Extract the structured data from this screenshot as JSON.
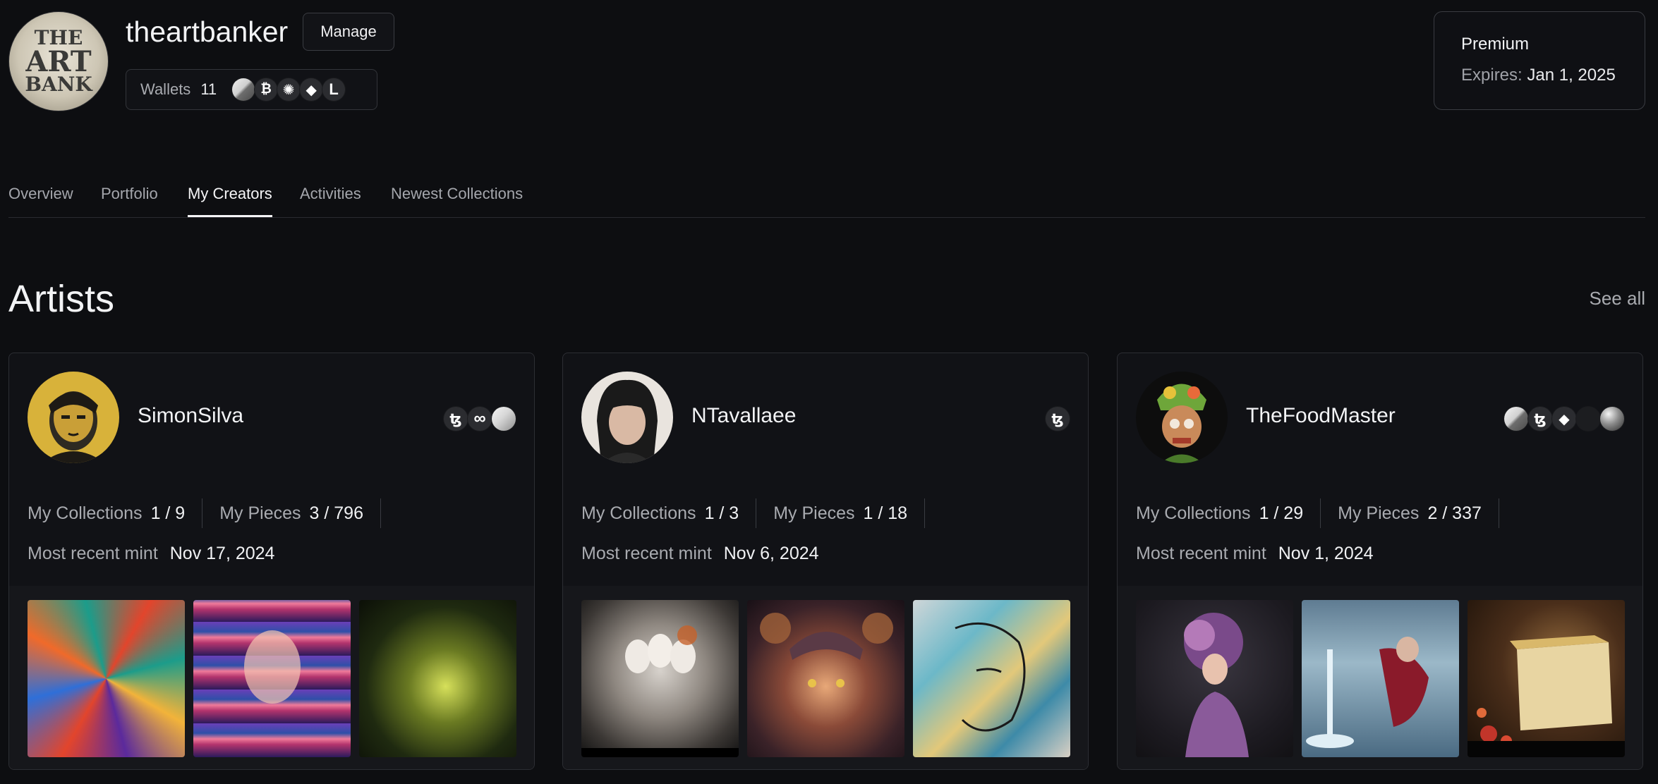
{
  "profile": {
    "logo_text": [
      "THE",
      "ART",
      "BANK"
    ],
    "username": "theartbanker",
    "manage_label": "Manage",
    "wallets_label": "Wallets",
    "wallets_count": "11",
    "wallet_chains": [
      "solana-icon",
      "bitcoin-icon",
      "cardano-icon",
      "ethereum-icon",
      "linea-icon"
    ]
  },
  "premium": {
    "tier": "Premium",
    "expires_label": "Expires:",
    "expires_date": "Jan 1, 2025"
  },
  "tabs": [
    {
      "label": "Overview",
      "active": false
    },
    {
      "label": "Portfolio",
      "active": false
    },
    {
      "label": "My Creators",
      "active": true
    },
    {
      "label": "Activities",
      "active": false
    },
    {
      "label": "Newest Collections",
      "active": false
    }
  ],
  "section": {
    "title": "Artists",
    "see_all": "See all"
  },
  "labels": {
    "collections": "My Collections",
    "pieces": "My Pieces",
    "mint": "Most recent mint"
  },
  "artists": [
    {
      "name": "SimonSilva",
      "chains": [
        "tezos-icon",
        "infinity-icon",
        "solana-icon"
      ],
      "collections": "1 / 9",
      "pieces": "3 / 796",
      "mint": "Nov 17, 2024",
      "thumbs": [
        "abstract-artwork",
        "glitch-portrait-artwork",
        "green-creatures-artwork"
      ]
    },
    {
      "name": "NTavallaee",
      "chains": [
        "tezos-icon"
      ],
      "collections": "1 / 3",
      "pieces": "1 / 18",
      "mint": "Nov 6, 2024",
      "thumbs": [
        "masks-artwork",
        "fantasy-woman-artwork",
        "painted-face-artwork"
      ]
    },
    {
      "name": "TheFoodMaster",
      "chains": [
        "solana-icon",
        "tezos-icon",
        "ethereum-icon",
        "dark-chain-icon",
        "sphere-icon"
      ],
      "collections": "1 / 29",
      "pieces": "2 / 337",
      "mint": "Nov 1, 2024",
      "thumbs": [
        "flower-dress-artwork",
        "water-pour-artwork",
        "cheese-mushrooms-artwork"
      ]
    }
  ],
  "colors": {
    "background": "#0d0e11",
    "card": "#111216",
    "border": "#2c2e33",
    "text_primary": "#f2f3f5",
    "text_muted": "#a9abb0"
  }
}
